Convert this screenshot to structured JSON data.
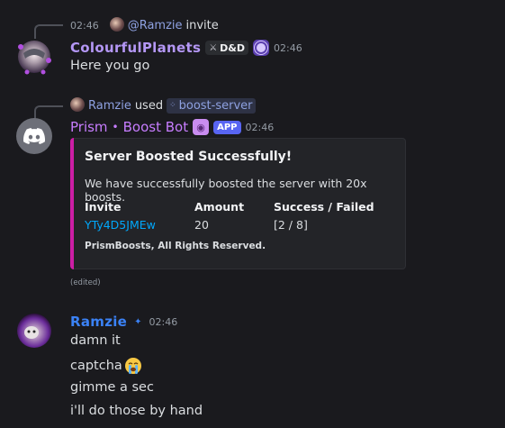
{
  "message1": {
    "reply": {
      "time": "02:46",
      "mention": "@Ramzie",
      "text": "invite"
    },
    "username": "ColourfulPlanets",
    "tag_label": "D&D",
    "time": "02:46",
    "content": "Here you go",
    "username_color": "#b497f5"
  },
  "message2": {
    "interaction": {
      "user": "Ramzie",
      "used": "used",
      "command": "boost-server"
    },
    "bot_name": "Prism",
    "bot_suffix": "Boost Bot",
    "app_badge": "APP",
    "time": "02:46",
    "username_color": "#c77dff",
    "embed": {
      "title": "Server Boosted Successfully!",
      "description": "We have successfully boosted the server with 20x boosts.",
      "fields": [
        {
          "name": "Invite",
          "value": "YTy4D5JMEw"
        },
        {
          "name": "Amount",
          "value": "20"
        },
        {
          "name": "Success / Failed",
          "value": "[2 / 8]"
        }
      ],
      "footer": "PrismBoosts, All Rights Reserved.",
      "accent_color": "#cc1ea5"
    },
    "edited": "(edited)"
  },
  "message3": {
    "username": "Ramzie",
    "username_color": "#3b82f6",
    "time": "02:46",
    "lines": [
      "damn it",
      "captcha",
      "gimme a sec",
      "i'll do those by hand"
    ],
    "emoji_name": "sob-emoji"
  }
}
